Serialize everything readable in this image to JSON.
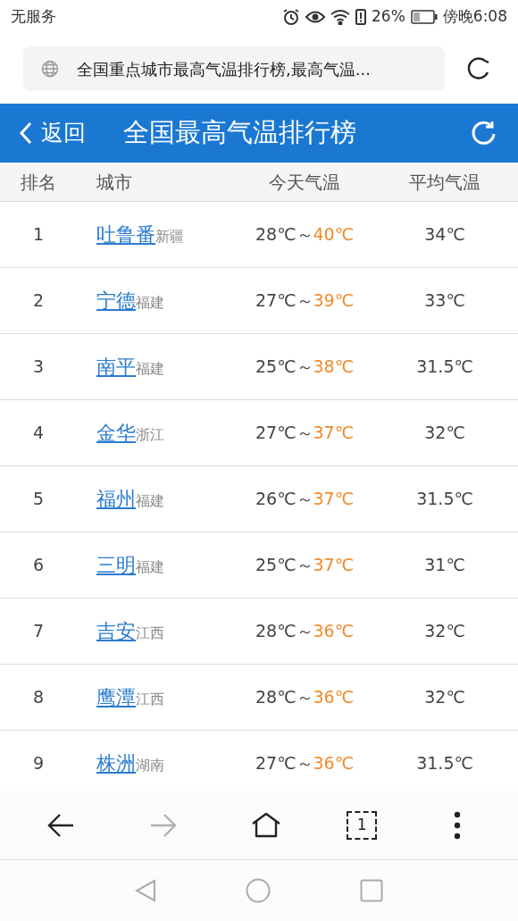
{
  "status_bar": {
    "carrier": "无服务",
    "battery": "26%",
    "time": "傍晚6:08"
  },
  "address_bar": {
    "title": "全国重点城市最高气温排行榜,最高气温..."
  },
  "header": {
    "back": "返回",
    "title": "全国最高气温排行榜"
  },
  "table": {
    "columns": [
      "排名",
      "城市",
      "今天气温",
      "平均气温"
    ],
    "rows": [
      {
        "rank": "1",
        "city": "吐鲁番",
        "province": "新疆",
        "low": "28℃",
        "sep": "～",
        "high": "40℃",
        "avg": "34℃"
      },
      {
        "rank": "2",
        "city": "宁德",
        "province": "福建",
        "low": "27℃",
        "sep": "～",
        "high": "39℃",
        "avg": "33℃"
      },
      {
        "rank": "3",
        "city": "南平",
        "province": "福建",
        "low": "25℃",
        "sep": "～",
        "high": "38℃",
        "avg": "31.5℃"
      },
      {
        "rank": "4",
        "city": "金华",
        "province": "浙江",
        "low": "27℃",
        "sep": "～",
        "high": "37℃",
        "avg": "32℃"
      },
      {
        "rank": "5",
        "city": "福州",
        "province": "福建",
        "low": "26℃",
        "sep": "～",
        "high": "37℃",
        "avg": "31.5℃"
      },
      {
        "rank": "6",
        "city": "三明",
        "province": "福建",
        "low": "25℃",
        "sep": "～",
        "high": "37℃",
        "avg": "31℃"
      },
      {
        "rank": "7",
        "city": "吉安",
        "province": "江西",
        "low": "28℃",
        "sep": "～",
        "high": "36℃",
        "avg": "32℃"
      },
      {
        "rank": "8",
        "city": "鹰潭",
        "province": "江西",
        "low": "28℃",
        "sep": "～",
        "high": "36℃",
        "avg": "32℃"
      },
      {
        "rank": "9",
        "city": "株洲",
        "province": "湖南",
        "low": "27℃",
        "sep": "～",
        "high": "36℃",
        "avg": "31.5℃"
      }
    ]
  },
  "toolbar": [
    {
      "kind": "back",
      "disabled": false
    },
    {
      "kind": "forward",
      "disabled": true
    },
    {
      "kind": "home",
      "disabled": false
    },
    {
      "kind": "tabs",
      "label": "1",
      "disabled": false
    },
    {
      "kind": "menu",
      "disabled": false
    }
  ]
}
